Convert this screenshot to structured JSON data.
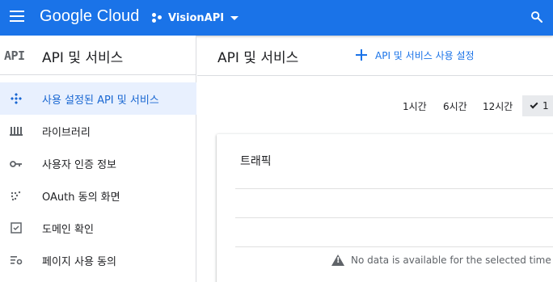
{
  "topbar": {
    "brand": "Google Cloud",
    "project_name": "VisionAPI",
    "color": "#1a73e8"
  },
  "sidebar": {
    "logo_text": "API",
    "title": "API 및 서비스",
    "items": [
      {
        "label": "사용 설정된 API 및 서비스",
        "icon": "diamond-nodes-icon",
        "active": true
      },
      {
        "label": "라이브러리",
        "icon": "library-icon",
        "active": false
      },
      {
        "label": "사용자 인증 정보",
        "icon": "key-icon",
        "active": false
      },
      {
        "label": "OAuth 동의 화면",
        "icon": "oauth-dots-icon",
        "active": false
      },
      {
        "label": "도메인 확인",
        "icon": "checkbox-icon",
        "active": false
      },
      {
        "label": "페이지 사용 동의",
        "icon": "settings-list-icon",
        "active": false
      }
    ]
  },
  "main": {
    "title": "API 및 서비스",
    "enable_button": "API 및 서비스 사용 설정",
    "time_ranges": [
      {
        "label": "1시간",
        "selected": false
      },
      {
        "label": "6시간",
        "selected": false
      },
      {
        "label": "12시간",
        "selected": false
      },
      {
        "label": "1",
        "selected": true
      }
    ],
    "card": {
      "title": "트래픽",
      "empty_message": "No data is available for the selected time fra"
    }
  },
  "colors": {
    "accent": "#1a73e8",
    "active_bg": "#e8f0fe",
    "active_text": "#1967d2",
    "icon_gray": "#5f6368"
  }
}
